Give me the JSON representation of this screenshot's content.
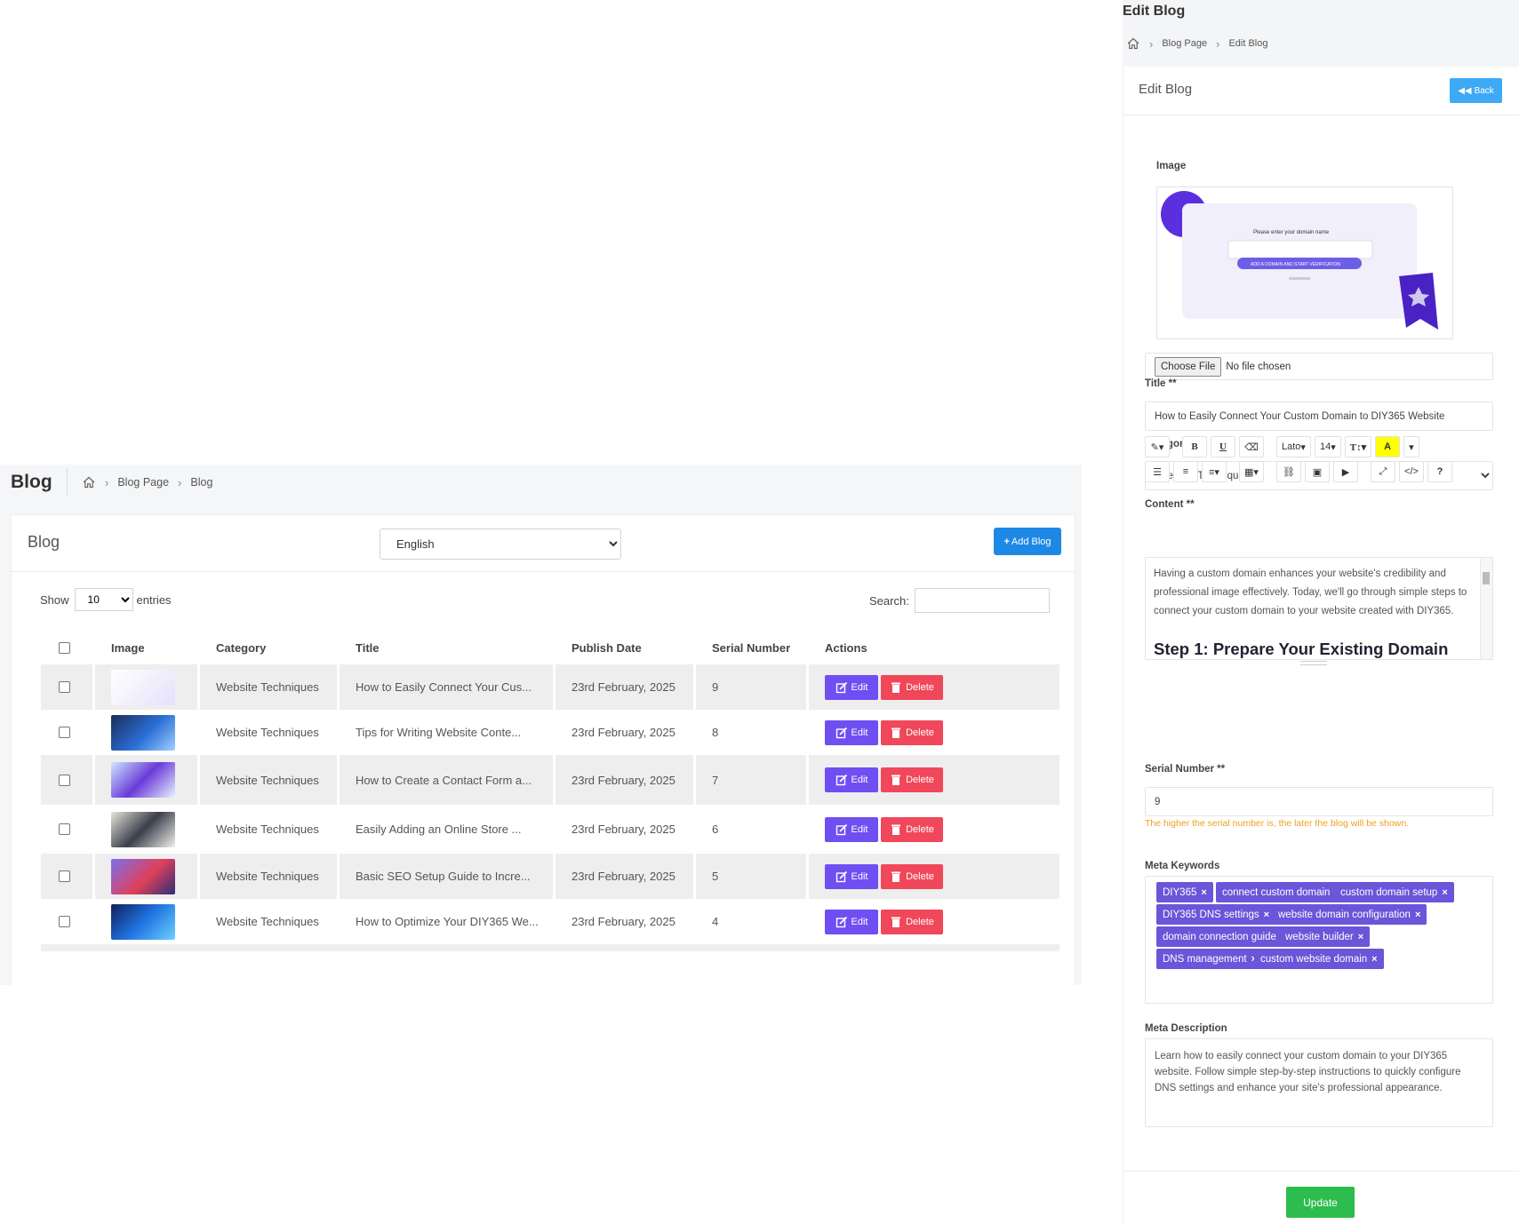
{
  "blog_list": {
    "page_title": "Blog",
    "breadcrumb": [
      "Blog Page",
      "Blog"
    ],
    "card_title": "Blog",
    "language": {
      "selected": "English"
    },
    "add_button": "Add Blog",
    "show_label": "Show",
    "entries_value": "10",
    "entries_label": "entries",
    "search_label": "Search:",
    "headers": [
      "Image",
      "Category",
      "Title",
      "Publish Date",
      "Serial Number",
      "Actions"
    ],
    "rows": [
      {
        "category": "Website Techniques",
        "title": "How to Easily Connect Your Cus...",
        "date": "23rd February, 2025",
        "serial": "9",
        "thumb": "domain-thumbnail"
      },
      {
        "category": "Website Techniques",
        "title": "Tips for Writing Website Conte...",
        "date": "23rd February, 2025",
        "serial": "8",
        "thumb": "content-thumbnail"
      },
      {
        "category": "Website Techniques",
        "title": "How to Create a Contact Form a...",
        "date": "23rd February, 2025",
        "serial": "7",
        "thumb": "contact-form-thumbnail"
      },
      {
        "category": "Website Techniques",
        "title": "Easily Adding an Online Store ...",
        "date": "23rd February, 2025",
        "serial": "6",
        "thumb": "online-store-thumbnail"
      },
      {
        "category": "Website Techniques",
        "title": "Basic SEO Setup Guide to Incre...",
        "date": "23rd February, 2025",
        "serial": "5",
        "thumb": "seo-thumbnail"
      },
      {
        "category": "Website Techniques",
        "title": "How to Optimize Your DIY365 We...",
        "date": "23rd February, 2025",
        "serial": "4",
        "thumb": "optimize-thumbnail"
      }
    ],
    "edit_label": "Edit",
    "delete_label": "Delete"
  },
  "edit_blog": {
    "page_title": "Edit Blog",
    "breadcrumb": [
      "Blog Page",
      "Edit Blog"
    ],
    "card_title": "Edit Blog",
    "back_label": "Back",
    "image_label": "Image",
    "preview": {
      "heading": "Please enter your domain name",
      "button": "ADD A DOMAIN AND START VERIFICATION"
    },
    "choose_file_label": "Choose File",
    "no_file_text": "No file chosen",
    "title_label": "Title **",
    "title_value": "How to Easily Connect Your Custom Domain to DIY365 Website",
    "category_label": "Category **",
    "category_value": "Website Techniques",
    "content_label": "Content **",
    "toolbar": {
      "font": "Lato",
      "size": "14"
    },
    "content_paragraph": "Having a custom domain enhances your website's credibility and professional image effectively. Today, we'll go through simple steps to connect your custom domain to your website created with DIY365.",
    "content_heading": "Step 1: Prepare Your Existing Domain",
    "serial_label": "Serial Number **",
    "serial_value": "9",
    "serial_hint": "The higher the serial number is, the later the blog will be shown.",
    "keywords_label": "Meta Keywords",
    "keywords": [
      "DIY365",
      "connect custom domain",
      "custom domain setup",
      "DIY365 DNS settings",
      "website domain configuration",
      "domain connection guide",
      "website builder",
      "DNS management",
      "custom website domain"
    ],
    "description_label": "Meta Description",
    "description_value": "Learn how to easily connect your custom domain to your DIY365 website. Follow simple step-by-step instructions to quickly configure DNS settings and enhance your site's professional appearance.",
    "update_label": "Update"
  },
  "colors": {
    "primary": "#1e88e5",
    "edit": "#6f4ef2",
    "delete": "#f0475a",
    "tag": "#6b55d9",
    "update": "#2dbd4e",
    "back": "#3ea9f5",
    "hint": "#f0a020"
  }
}
